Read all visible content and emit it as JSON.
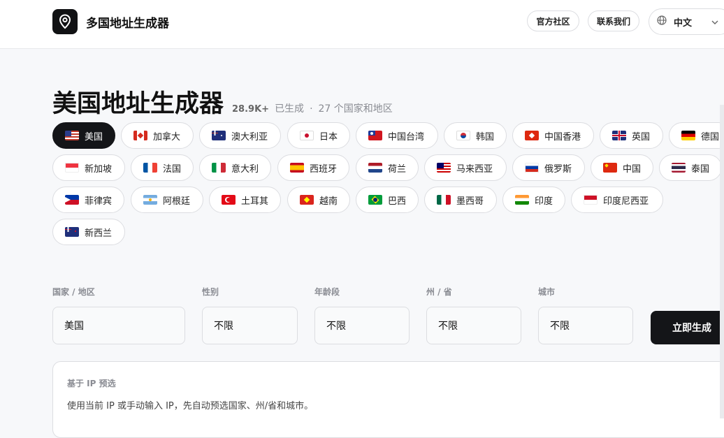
{
  "header": {
    "brand": "多国地址生成器",
    "community_label": "官方社区",
    "contact_label": "联系我们",
    "language_label": "中文"
  },
  "main": {
    "title": "美国地址生成器",
    "generated_count": "28.9K+",
    "generated_suffix": "已生成",
    "separator": "·",
    "coverage": "27 个国家和地区"
  },
  "countries": [
    {
      "name": "美国",
      "flag": "us-flag",
      "selected": true
    },
    {
      "name": "加拿大",
      "flag": "ca-flag"
    },
    {
      "name": "澳大利亚",
      "flag": "au-flag"
    },
    {
      "name": "日本",
      "flag": "jp-flag"
    },
    {
      "name": "中国台湾",
      "flag": "tw-flag"
    },
    {
      "name": "韩国",
      "flag": "kr-flag"
    },
    {
      "name": "中国香港",
      "flag": "hk-flag"
    },
    {
      "name": "英国",
      "flag": "gb-flag"
    },
    {
      "name": "德国",
      "flag": "de-flag"
    },
    {
      "name": "新加坡",
      "flag": "sg-flag"
    },
    {
      "name": "法国",
      "flag": "fr-flag"
    },
    {
      "name": "意大利",
      "flag": "it-flag"
    },
    {
      "name": "西班牙",
      "flag": "es-flag"
    },
    {
      "name": "荷兰",
      "flag": "nl-flag"
    },
    {
      "name": "马来西亚",
      "flag": "my-flag"
    },
    {
      "name": "俄罗斯",
      "flag": "ru-flag"
    },
    {
      "name": "中国",
      "flag": "cn-flag"
    },
    {
      "name": "泰国",
      "flag": "th-flag"
    },
    {
      "name": "菲律宾",
      "flag": "ph-flag"
    },
    {
      "name": "阿根廷",
      "flag": "ar-flag"
    },
    {
      "name": "土耳其",
      "flag": "tr-flag"
    },
    {
      "name": "越南",
      "flag": "vn-flag"
    },
    {
      "name": "巴西",
      "flag": "br-flag"
    },
    {
      "name": "墨西哥",
      "flag": "mx-flag"
    },
    {
      "name": "印度",
      "flag": "in-flag"
    },
    {
      "name": "印度尼西亚",
      "flag": "id-flag"
    },
    {
      "name": "新西兰",
      "flag": "nz-flag"
    }
  ],
  "form": {
    "country": {
      "label": "国家 / 地区",
      "value": "美国"
    },
    "gender": {
      "label": "性别",
      "value": "不限"
    },
    "age": {
      "label": "年龄段",
      "value": "不限"
    },
    "state": {
      "label": "州 / 省",
      "value": "不限"
    },
    "city": {
      "label": "城市",
      "value": "不限"
    },
    "generate_label": "立即生成"
  },
  "ip_panel": {
    "title": "基于 IP 预选",
    "description": "使用当前 IP 或手动输入 IP，先自动预选国家、州/省和城市。"
  },
  "colors": {
    "accent": "#141518",
    "background": "#f7f8fa",
    "border": "#dcdde1",
    "muted_text": "#8a8c93"
  }
}
